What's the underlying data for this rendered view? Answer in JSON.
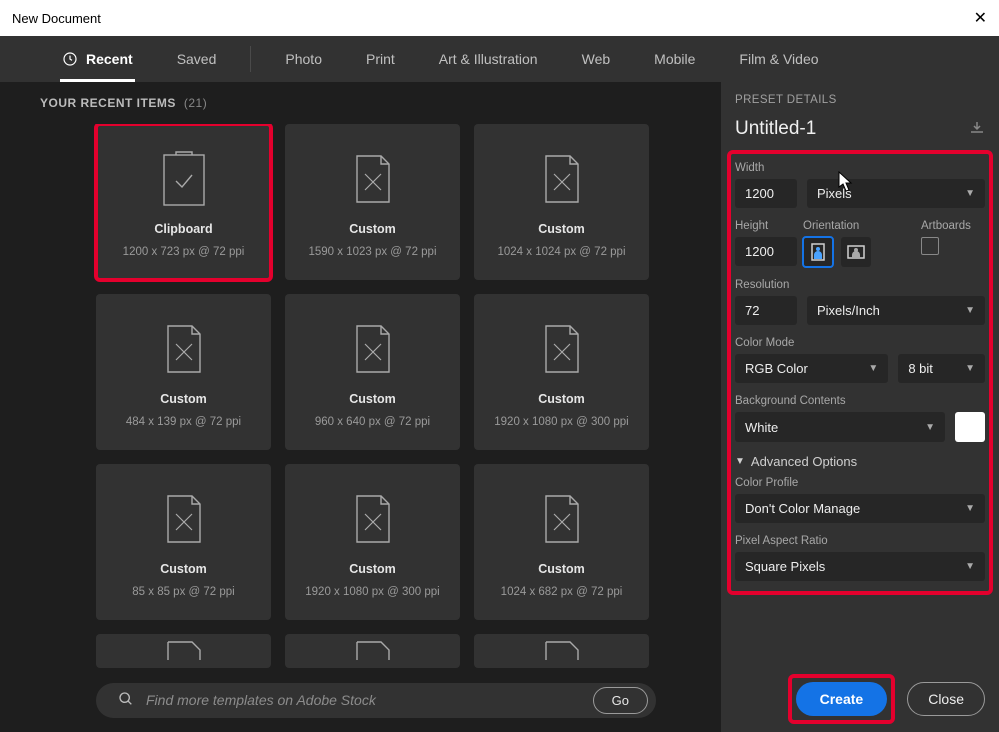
{
  "window": {
    "title": "New Document"
  },
  "tabs": {
    "recent": "Recent",
    "saved": "Saved",
    "photo": "Photo",
    "print": "Print",
    "art": "Art & Illustration",
    "web": "Web",
    "mobile": "Mobile",
    "film": "Film & Video"
  },
  "section": {
    "title": "YOUR RECENT ITEMS",
    "count": "(21)"
  },
  "cards": [
    {
      "title": "Clipboard",
      "sub": "1200 x 723 px @ 72 ppi"
    },
    {
      "title": "Custom",
      "sub": "1590 x 1023 px @ 72 ppi"
    },
    {
      "title": "Custom",
      "sub": "1024 x 1024 px @ 72 ppi"
    },
    {
      "title": "Custom",
      "sub": "484 x 139 px @ 72 ppi"
    },
    {
      "title": "Custom",
      "sub": "960 x 640 px @ 72 ppi"
    },
    {
      "title": "Custom",
      "sub": "1920 x 1080 px @ 300 ppi"
    },
    {
      "title": "Custom",
      "sub": "85 x 85 px @ 72 ppi"
    },
    {
      "title": "Custom",
      "sub": "1920 x 1080 px @ 300 ppi"
    },
    {
      "title": "Custom",
      "sub": "1024 x 682 px @ 72 ppi"
    }
  ],
  "search": {
    "placeholder": "Find more templates on Adobe Stock",
    "go": "Go"
  },
  "preset": {
    "header": "PRESET DETAILS",
    "name": "Untitled-1",
    "width_label": "Width",
    "width_value": "1200",
    "width_unit": "Pixels",
    "height_label": "Height",
    "height_value": "1200",
    "orientation_label": "Orientation",
    "artboards_label": "Artboards",
    "resolution_label": "Resolution",
    "resolution_value": "72",
    "resolution_unit": "Pixels/Inch",
    "colormode_label": "Color Mode",
    "colormode_value": "RGB Color",
    "bitdepth": "8 bit",
    "bg_label": "Background Contents",
    "bg_value": "White",
    "advanced": "Advanced Options",
    "profile_label": "Color Profile",
    "profile_value": "Don't Color Manage",
    "par_label": "Pixel Aspect Ratio",
    "par_value": "Square Pixels"
  },
  "footer": {
    "create": "Create",
    "close": "Close"
  }
}
